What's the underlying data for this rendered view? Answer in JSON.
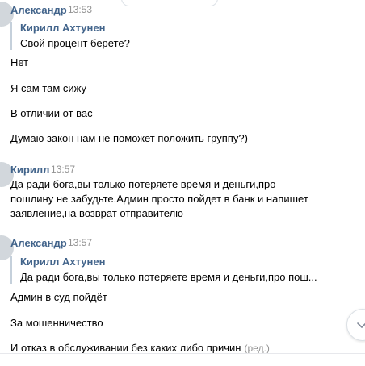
{
  "date_divider": "",
  "messages": [
    {
      "author": "Александр",
      "time": "13:53",
      "quote": {
        "author": "Кирилл Ахтунен",
        "text": "Свой процент берете?"
      },
      "lines": [
        "Нет",
        "Я сам там сижу",
        "В отличии от вас",
        "Думаю закон нам не поможет положить группу?)"
      ]
    },
    {
      "author": "Кирилл",
      "time": "13:57",
      "lines": [
        "Да ради бога,вы только потеряете время и деньги,про",
        "пошлину не забудьте.Админ просто пойдет в банк и напишет",
        "заявление,на возврат отправителю"
      ]
    },
    {
      "author": "Александр",
      "time": "13:57",
      "quote": {
        "author": "Кирилл Ахтунен",
        "text": "Да ради бога,вы только потеряете время и деньги,про пош..."
      },
      "lines": [
        "Админ в суд пойдёт",
        "За мошенничество",
        "И отказ в обслуживании без каких либо причин"
      ],
      "edited_label": "(ред.)"
    }
  ],
  "scroll_button": {
    "icon": "chevron-down-icon"
  },
  "colors": {
    "author": "#42648b",
    "time": "#939393",
    "quote_bar": "#c5d0db",
    "text": "#000000"
  }
}
